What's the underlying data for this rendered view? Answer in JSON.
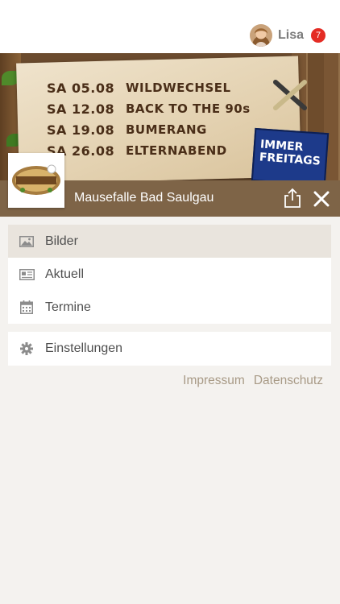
{
  "header": {
    "user_name": "Lisa",
    "notification_count": "7",
    "avatar_icon": "user-avatar"
  },
  "banner": {
    "events": [
      {
        "date": "SA 05.08",
        "title": "WILDWECHSEL"
      },
      {
        "date": "SA 12.08",
        "title": "BACK TO THE 90s"
      },
      {
        "date": "SA 19.08",
        "title": "BUMERANG"
      },
      {
        "date": "SA 26.08",
        "title": "ELTERNABEND"
      }
    ],
    "promo_line1": "IMMER",
    "promo_line2": "FREITAGS"
  },
  "titlebar": {
    "title": "Mausefalle Bad Saulgau",
    "share_icon": "share-icon",
    "close_icon": "close-icon"
  },
  "menu": {
    "items": [
      {
        "label": "Bilder",
        "icon": "image-icon",
        "active": true
      },
      {
        "label": "Aktuell",
        "icon": "newspaper-icon",
        "active": false
      },
      {
        "label": "Termine",
        "icon": "calendar-icon",
        "active": false
      }
    ],
    "settings": {
      "label": "Einstellungen",
      "icon": "gear-icon"
    }
  },
  "footer": {
    "impressum": "Impressum",
    "datenschutz": "Datenschutz"
  },
  "colors": {
    "brown_bar": "#7e6447",
    "badge_red": "#e42c24",
    "link_color": "#a89a86",
    "background": "#f4f2ef"
  }
}
